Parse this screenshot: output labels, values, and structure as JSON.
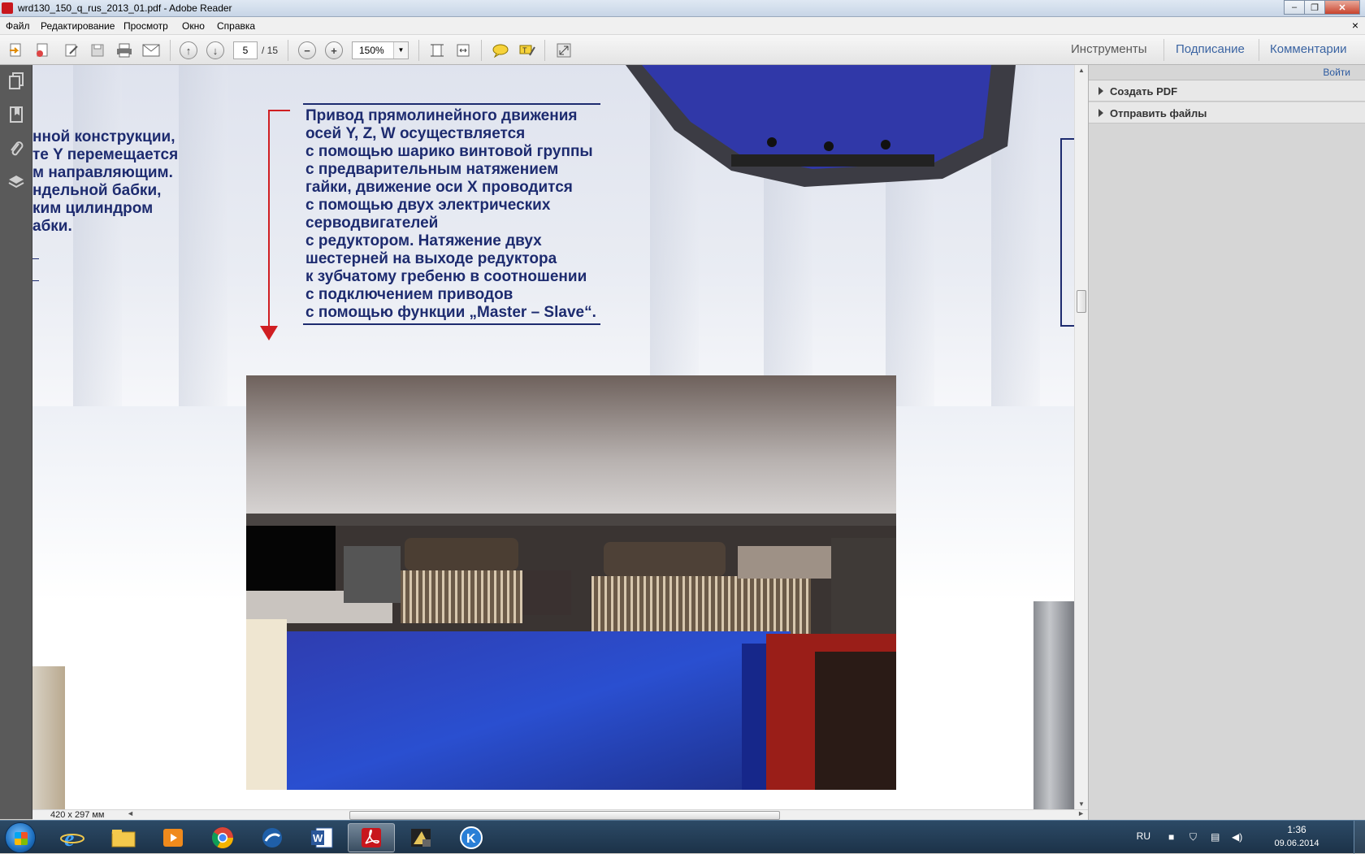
{
  "window": {
    "title": "wrd130_150_q_rus_2013_01.pdf - Adobe Reader",
    "controls": [
      "–",
      "❐",
      "✕"
    ]
  },
  "menu": {
    "items": [
      "Файл",
      "Редактирование",
      "Просмотр",
      "Окно",
      "Справка"
    ],
    "close_doc": "×"
  },
  "toolbar": {
    "page_current": "5",
    "page_total": "/ 15",
    "zoom": "150%",
    "links": [
      "Инструменты",
      "Подписание",
      "Комментарии"
    ]
  },
  "document": {
    "left_text": "нной конструкции,\nте Y перемещается\nм направляющим.\nндельной бабки,\nким цилиндром\nабки.",
    "main_text_lines": [
      "Привод прямолинейного движения",
      "осей Y, Z, W осуществляется",
      "с помощью шарико винтовой группы",
      "с предварительным натяжением",
      "гайки, движение оси X проводится",
      "с помощью двух электрических",
      "серводвигателей",
      "с редуктором. Натяжение двух",
      "шестерней на выходе редуктора",
      "к зубчатому гребеню в соотношении",
      "с подключением приводов",
      "с помощью функции „Master – Slave“."
    ],
    "page_size": "420 x 297 мм"
  },
  "right_panel": {
    "login": "Войти",
    "sections": [
      "Создать PDF",
      "Отправить файлы"
    ]
  },
  "taskbar": {
    "lang": "RU",
    "time": "1:36",
    "date": "09.06.2014"
  }
}
